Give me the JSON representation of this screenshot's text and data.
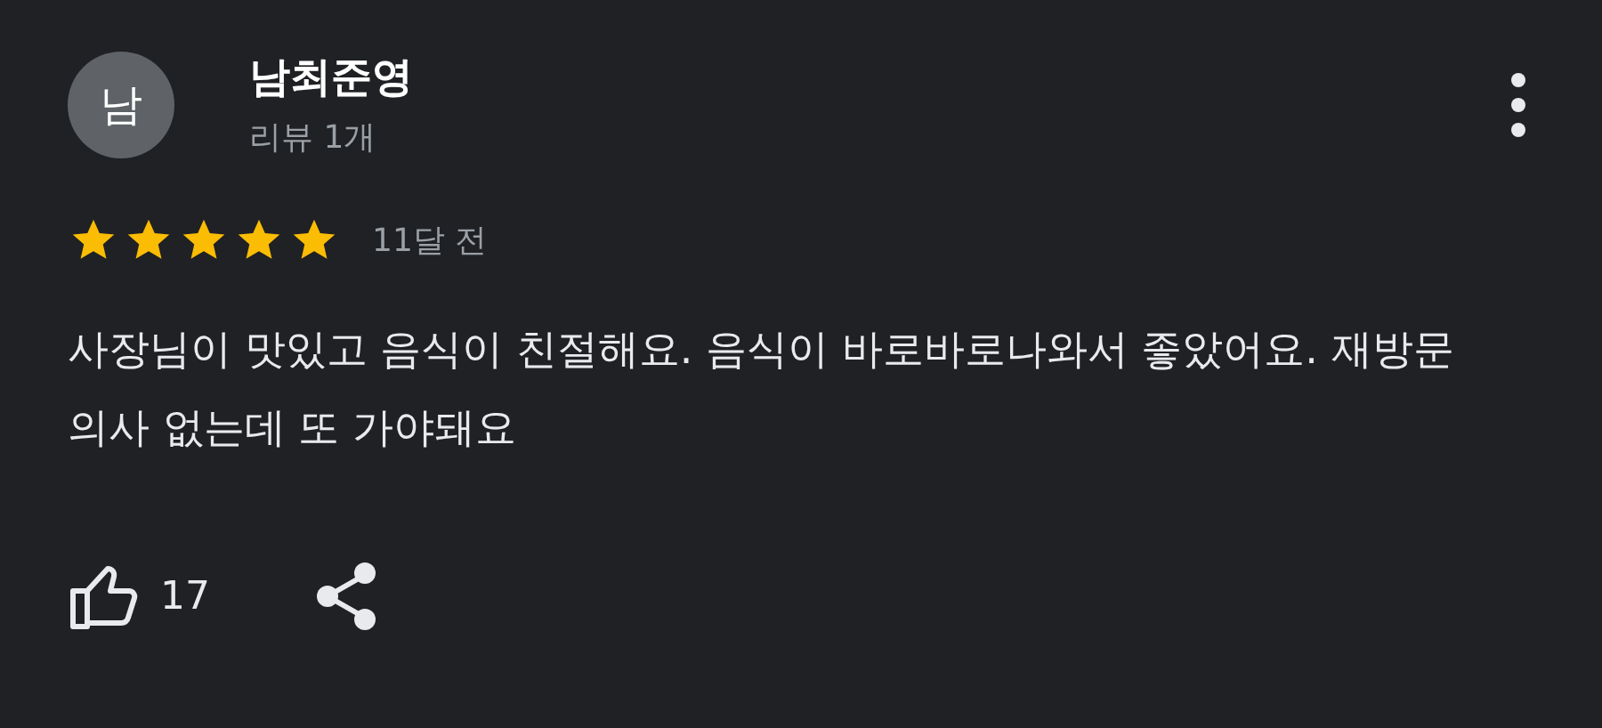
{
  "reviewer": {
    "avatar_letter": "남",
    "name": "남최준영",
    "review_count": "리뷰 1개"
  },
  "rating": {
    "stars": 5,
    "time": "11달 전"
  },
  "review_text": "사장님이 맛있고 음식이 친절해요. 음식이 바로바로나와서 좋았어요. 재방문의사 없는데 또 가야돼요",
  "likes": "17"
}
